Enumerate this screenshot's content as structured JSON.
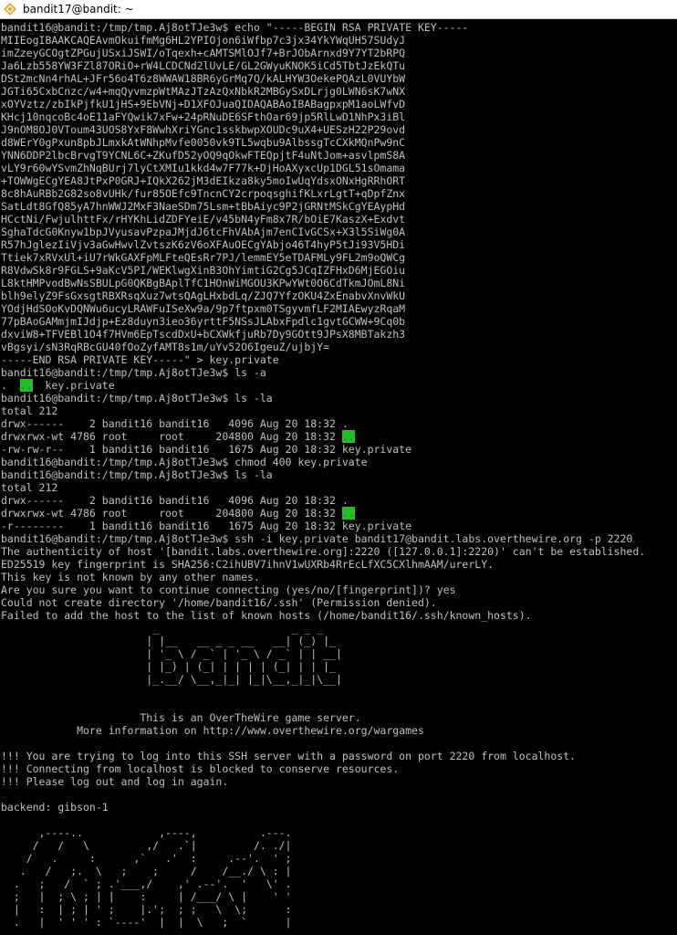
{
  "window": {
    "title": "bandit17@bandit: ~",
    "accent_color": "#f4a324",
    "icon_name": "putty-terminal-icon"
  },
  "colors": {
    "background": "#000000",
    "foreground": "#c0c0c0",
    "highlight_bg": "#25bc24",
    "highlight_fg": "#3b48e3"
  },
  "terminal": {
    "lines": [
      {
        "segments": [
          {
            "text": "bandit16@bandit:/tmp/tmp.Aj8otTJe3w$ echo \"-----BEGIN RSA PRIVATE KEY-----"
          }
        ]
      },
      {
        "segments": [
          {
            "text": "MIIEogIBAAKCAQEAvmOkuifmMg6HL2YPIOjon6iWfbp7c3jx34YkYWqUH57SUdyJ"
          }
        ]
      },
      {
        "segments": [
          {
            "text": "imZzeyGCOgtZPGujUSxiJSWI/oTqexh+cAMTSMlOJf7+BrJObArnxd9Y7YT2bRPQ"
          }
        ]
      },
      {
        "segments": [
          {
            "text": "Ja6Lzb558YW3FZl87ORiO+rW4LCDCNd2lUvLE/GL2GWyuKNOK5iCd5TbtJzEkQTu"
          }
        ]
      },
      {
        "segments": [
          {
            "text": "DSt2mcNn4rhAL+JFr56o4T6z8WWAW18BR6yGrMq7Q/kALHYW3OekePQAzL0VUYbW"
          }
        ]
      },
      {
        "segments": [
          {
            "text": "JGTi65CxbCnzc/w4+mqQyvmzpWtMAzJTzAzQxNbkR2MBGySxDLrjg0LWN6sK7wNX"
          }
        ]
      },
      {
        "segments": [
          {
            "text": "xOYVztz/zbIkPjfkU1jHS+9EbVNj+D1XFOJuaQIDAQABAoIBABagpxpM1aoLWfvD"
          }
        ]
      },
      {
        "segments": [
          {
            "text": "KHcj10nqcoBc4oE11aFYQwik7xFw+24pRNuDE6SFthOar69jp5RlLwD1NhPx3iBl"
          }
        ]
      },
      {
        "segments": [
          {
            "text": "J9nOM8OJ0VToum43UOS8YxF8WwhXriYGnc1sskbwpXOUDc9uX4+UESzH22P29ovd"
          }
        ]
      },
      {
        "segments": [
          {
            "text": "d8WErY0gPxun8pbJLmxkAtWNhpMvfe0050vk9TL5wqbu9AlbssgTcCXkMQnPw9nC"
          }
        ]
      },
      {
        "segments": [
          {
            "text": "YNN6DDP2lbcBrvgT9YCNL6C+ZKufD52yOQ9qOkwFTEQpjtF4uNtJom+asvlpmS8A"
          }
        ]
      },
      {
        "segments": [
          {
            "text": "vLY9r60wYSvmZhNqBUrj7lyCtXMIu1kkd4w7F77k+DjHoAXyxcUp1DGL51sOmama"
          }
        ]
      },
      {
        "segments": [
          {
            "text": "+TOWWgECgYEA8JtPxP0GRJ+IQkX262jM3dEIkza8ky5moIwUqYdsxONxHgRRhORT"
          }
        ]
      },
      {
        "segments": [
          {
            "text": "8c8hAuRBb2G82so8vUHk/fur85OEfc9TncnCY2crpoqsghifKLxrLgtT+qDpfZnx"
          }
        ]
      },
      {
        "segments": [
          {
            "text": "SatLdt8GfQ85yA7hnWWJ2MxF3NaeSDm75Lsm+tBbAiyc9P2jGRNtMSkCgYEAypHd"
          }
        ]
      },
      {
        "segments": [
          {
            "text": "HCctNi/FwjulhttFx/rHYKhLidZDFYeiE/v45bN4yFm8x7R/bOiE7KaszX+Exdvt"
          }
        ]
      },
      {
        "segments": [
          {
            "text": "SghaTdcG0Knyw1bpJVyusavPzpaJMjdJ6tcFhVAbAjm7enCIvGCSx+X3l5SiWg0A"
          }
        ]
      },
      {
        "segments": [
          {
            "text": "R57hJglezIiVjv3aGwHwvlZvtszK6zV6oXFAuOECgYAbjo46T4hyP5tJi93V5HDi"
          }
        ]
      },
      {
        "segments": [
          {
            "text": "Ttiek7xRVxUl+iU7rWkGAXFpMLFteQEsRr7PJ/lemmEY5eTDAFMLy9FL2m9oQWCg"
          }
        ]
      },
      {
        "segments": [
          {
            "text": "R8VdwSk8r9FGLS+9aKcV5PI/WEKlwgXinB3OhYimtiG2Cg5JCqIZFHxD6MjEGOiu"
          }
        ]
      },
      {
        "segments": [
          {
            "text": "L8ktHMPvodBwNsSBULpG0QKBgBAplTfC1HOnWiMGOU3KPwYWt0O6CdTkmJOmL8Ni"
          }
        ]
      },
      {
        "segments": [
          {
            "text": "blh9elyZ9FsGxsgtRBXRsqXuz7wtsQAgLHxbdLq/ZJQ7YfzOKU4ZxEnabvXnvWkU"
          }
        ]
      },
      {
        "segments": [
          {
            "text": "YOdjHdSOoKvDQNWu6ucyLRAWFuISeXw9a/9p7ftpxm0TSgyvmfLF2MIAEwyzRqaM"
          }
        ]
      },
      {
        "segments": [
          {
            "text": "77pBAoGAMmjmIJdjp+Ez8duyn3ieo36yrttF5NSsJLAbxFpdlc1gvtGCWW+9Cq0b"
          }
        ]
      },
      {
        "segments": [
          {
            "text": "dxviW8+TFVEBl1O4f7HVm6EpTscdDxU+bCXWkfjuRb7Dy9GOtt9JPsX8MBTakzh3"
          }
        ]
      },
      {
        "segments": [
          {
            "text": "vBgsyi/sN3RqRBcGU40fOoZyfAMT8s1m/uYv52O6IgeuZ/ujbjY="
          }
        ]
      },
      {
        "segments": [
          {
            "text": "-----END RSA PRIVATE KEY-----\" > key.private"
          }
        ]
      },
      {
        "segments": [
          {
            "text": "bandit16@bandit:/tmp/tmp.Aj8otTJe3w$ ls -a"
          }
        ]
      },
      {
        "segments": [
          {
            "text": ".  "
          },
          {
            "text": "..",
            "hl": true
          },
          {
            "text": "  key.private"
          }
        ]
      },
      {
        "segments": [
          {
            "text": "bandit16@bandit:/tmp/tmp.Aj8otTJe3w$ ls -la"
          }
        ]
      },
      {
        "segments": [
          {
            "text": "total 212"
          }
        ]
      },
      {
        "segments": [
          {
            "text": "drwx------    2 bandit16 bandit16   4096 Aug 20 18:32 ."
          }
        ]
      },
      {
        "segments": [
          {
            "text": "drwxrwx-wt 4786 root     root     204800 Aug 20 18:32 "
          },
          {
            "text": "..",
            "hl": true
          }
        ]
      },
      {
        "segments": [
          {
            "text": "-rw-rw-r--    1 bandit16 bandit16   1675 Aug 20 18:32 key.private"
          }
        ]
      },
      {
        "segments": [
          {
            "text": "bandit16@bandit:/tmp/tmp.Aj8otTJe3w$ chmod 400 key.private"
          }
        ]
      },
      {
        "segments": [
          {
            "text": "bandit16@bandit:/tmp/tmp.Aj8otTJe3w$ ls -la"
          }
        ]
      },
      {
        "segments": [
          {
            "text": "total 212"
          }
        ]
      },
      {
        "segments": [
          {
            "text": "drwx------    2 bandit16 bandit16   4096 Aug 20 18:32 ."
          }
        ]
      },
      {
        "segments": [
          {
            "text": "drwxrwx-wt 4786 root     root     204800 Aug 20 18:32 "
          },
          {
            "text": "..",
            "hl": true
          }
        ]
      },
      {
        "segments": [
          {
            "text": "-r--------    1 bandit16 bandit16   1675 Aug 20 18:32 key.private"
          }
        ]
      },
      {
        "segments": [
          {
            "text": "bandit16@bandit:/tmp/tmp.Aj8otTJe3w$ ssh -i key.private bandit17@bandit.labs.overthewire.org -p 2220"
          }
        ]
      },
      {
        "segments": [
          {
            "text": "The authenticity of host '[bandit.labs.overthewire.org]:2220 ([127.0.0.1]:2220)' can't be established."
          }
        ]
      },
      {
        "segments": [
          {
            "text": "ED25519 key fingerprint is SHA256:C2ihUBV7ihnV1wUXRb4RrEcLfXC5CXlhmAAM/urerLY."
          }
        ]
      },
      {
        "segments": [
          {
            "text": "This key is not known by any other names."
          }
        ]
      },
      {
        "segments": [
          {
            "text": "Are you sure you want to continue connecting (yes/no/[fingerprint])? yes"
          }
        ]
      },
      {
        "segments": [
          {
            "text": "Could not create directory '/home/bandit16/.ssh' (Permission denied)."
          }
        ]
      },
      {
        "segments": [
          {
            "text": "Failed to add the host to the list of known hosts (/home/bandit16/.ssh/known_hosts)."
          }
        ]
      },
      {
        "segments": [
          {
            "text": "                        _                     _ _ _"
          }
        ]
      },
      {
        "segments": [
          {
            "text": "                       | |__   __ _ _ __   __| (_) |_"
          }
        ]
      },
      {
        "segments": [
          {
            "text": "                       | '_ \\ / _` | '_ \\ / _` | | __|"
          }
        ]
      },
      {
        "segments": [
          {
            "text": "                       | |_) | (_| | | | | (_| | | |_"
          }
        ]
      },
      {
        "segments": [
          {
            "text": "                       |_.__/ \\__,_|_| |_|\\__,_|_|\\__|"
          }
        ]
      },
      {
        "segments": [
          {
            "text": ""
          }
        ]
      },
      {
        "segments": [
          {
            "text": ""
          }
        ]
      },
      {
        "segments": [
          {
            "text": "                      This is an OverTheWire game server."
          }
        ]
      },
      {
        "segments": [
          {
            "text": "            More information on http://www.overthewire.org/wargames"
          }
        ]
      },
      {
        "segments": [
          {
            "text": ""
          }
        ]
      },
      {
        "segments": [
          {
            "text": "!!! You are trying to log into this SSH server with a password on port 2220 from localhost."
          }
        ]
      },
      {
        "segments": [
          {
            "text": "!!! Connecting from localhost is blocked to conserve resources."
          }
        ]
      },
      {
        "segments": [
          {
            "text": "!!! Please log out and log in again."
          }
        ]
      },
      {
        "segments": [
          {
            "text": ""
          }
        ]
      },
      {
        "segments": [
          {
            "text": "backend: gibson-1"
          }
        ]
      },
      {
        "segments": [
          {
            "text": ""
          }
        ]
      },
      {
        "segments": [
          {
            "text": "      ,----..            ,----,          .---."
          }
        ]
      },
      {
        "segments": [
          {
            "text": "     /   /   \\         ,/   .`|         /. ./|"
          }
        ]
      },
      {
        "segments": [
          {
            "text": "    /   .     :      ,`   .'  :     .--'.  ' ;"
          }
        ]
      },
      {
        "segments": [
          {
            "text": "   .   /   ;.  \\   ;    ;     /    /__./ \\ : |"
          }
        ]
      },
      {
        "segments": [
          {
            "text": "  .   ;   /  ` ; .'___,/    ,' .--'.  '   \\' ."
          }
        ]
      },
      {
        "segments": [
          {
            "text": "  ;   |  ; \\ ; | |    :     | /___/ \\ |    ' '"
          }
        ]
      },
      {
        "segments": [
          {
            "text": "  |   :  | ; | ' ;    |.';  ; ;   \\  \\;      :"
          }
        ]
      },
      {
        "segments": [
          {
            "text": "  .   |  ' ' ' : `----'  |  |  \\   ;  `      |"
          }
        ]
      }
    ]
  }
}
